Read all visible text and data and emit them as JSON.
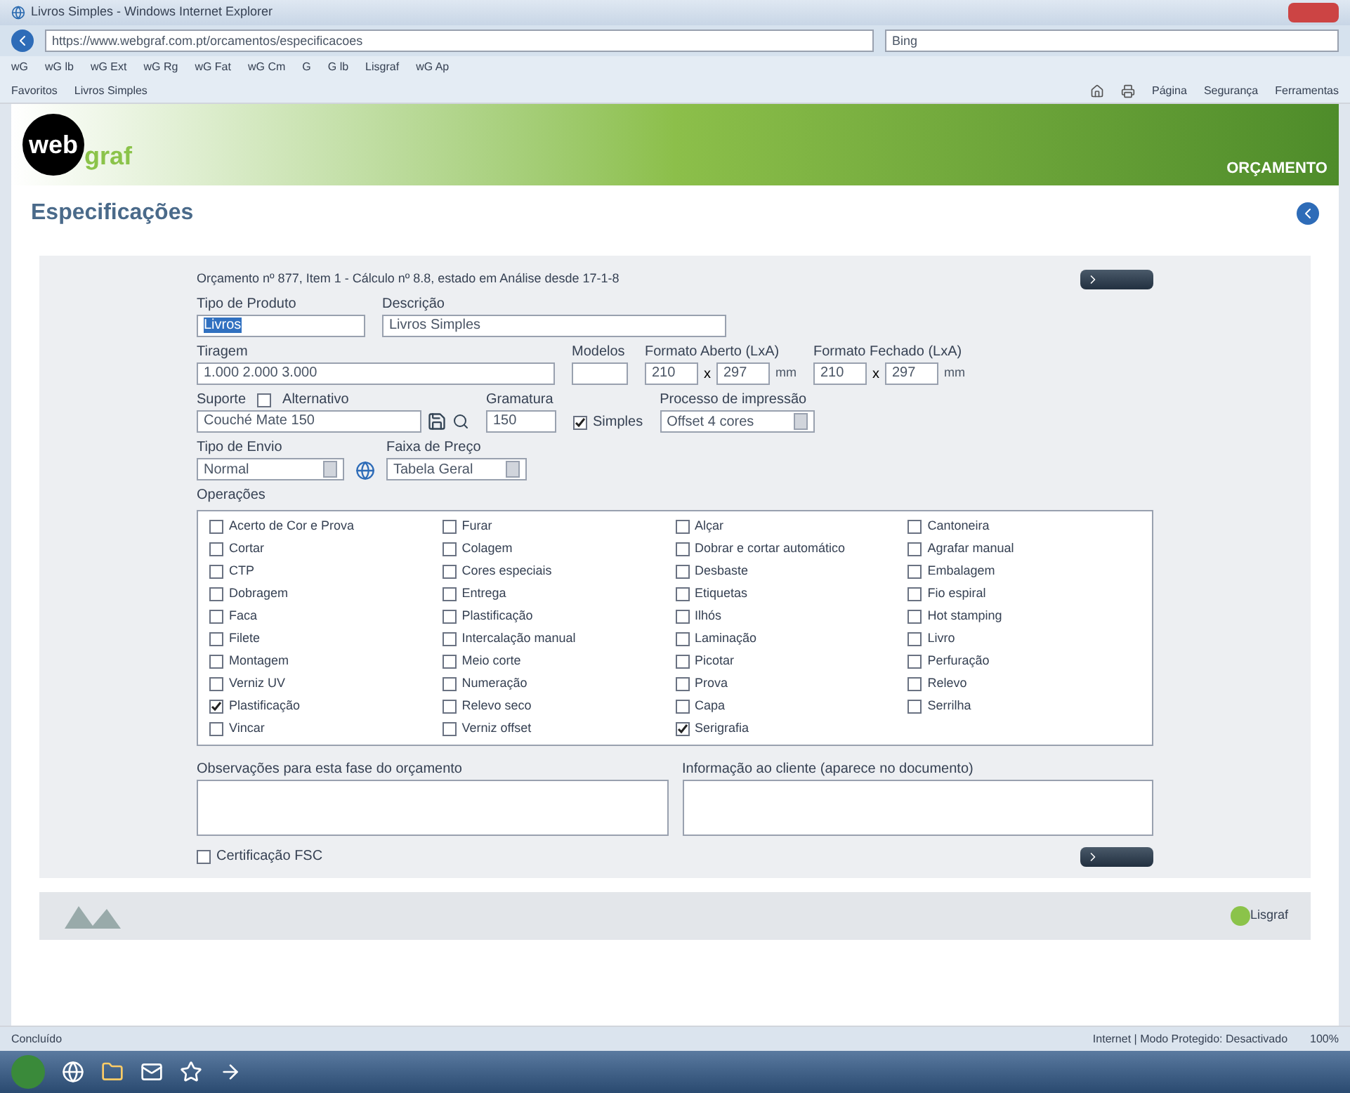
{
  "browser": {
    "title": "Livros Simples - Windows Internet Explorer",
    "address": "https://www.webgraf.com.pt/orcamentos/especificacoes",
    "search": "Bing",
    "favorites": [
      "Favoritos",
      "Livros Simples"
    ],
    "links": [
      "wG",
      "wG lb",
      "wG Ext",
      "wG Rg",
      "wG Fat",
      "wG Cm",
      "G",
      "G lb",
      "Lisgraf",
      "wG Ap"
    ],
    "commands": [
      "Página",
      "Segurança",
      "Ferramentas"
    ]
  },
  "banner": {
    "logo_top": "web",
    "logo_bottom": "graf",
    "section": "ORÇAMENTO"
  },
  "page": {
    "title": "Especificações"
  },
  "form": {
    "summary": "Orçamento nº 877, Item 1 - Cálculo nº 8.8, estado em Análise desde 17-1-8",
    "fields": [
      {
        "label": "Tipo de Produto",
        "value": "Livros"
      },
      {
        "label": "Descrição",
        "value": "Livros Simples"
      }
    ],
    "fields2": [
      {
        "kind": "text",
        "label": "Tiragem",
        "value": "1.000 2.000 3.000"
      },
      {
        "kind": "text",
        "label": "Modelos"
      },
      {
        "kind": "pair",
        "label": "Formato Aberto (LxA)",
        "value": "210",
        "separator": "x",
        "value2": "297",
        "unit": "mm"
      },
      {
        "kind": "pair",
        "label": "Formato Fechado (LxA)",
        "value": "210",
        "separator": "x",
        "value2": "297",
        "unit": "mm"
      }
    ],
    "support": {
      "label": "Suporte",
      "option": "Alternativo",
      "option_checked": false,
      "value": "Couché Mate 150"
    },
    "weight": {
      "label": "Gramatura",
      "value": "150"
    },
    "simplex": {
      "label": "Simples",
      "checked": true
    },
    "process": {
      "label": "Processo de impressão",
      "value": "Offset 4 cores"
    },
    "ship": {
      "label": "Tipo de Envio",
      "value": "Normal"
    },
    "range": {
      "label": "Faixa de Preço",
      "value": "Tabela Geral"
    },
    "operations_label": "Operações",
    "operations": [
      [
        {
          "label": "Acerto de Cor e Prova",
          "checked": false
        },
        {
          "label": "Cortar",
          "checked": false
        },
        {
          "label": "CTP",
          "checked": false
        },
        {
          "label": "Dobragem",
          "checked": false
        },
        {
          "label": "Faca",
          "checked": false
        },
        {
          "label": "Filete",
          "checked": false
        },
        {
          "label": "Montagem",
          "checked": false
        },
        {
          "label": "Verniz UV",
          "checked": false
        },
        {
          "label": "Plastificação",
          "checked": true
        },
        {
          "label": "Vincar",
          "checked": false
        }
      ],
      [
        {
          "label": "Furar",
          "checked": false
        },
        {
          "label": "Colagem",
          "checked": false
        },
        {
          "label": "Cores especiais",
          "checked": false
        },
        {
          "label": "Entrega",
          "checked": false
        },
        {
          "label": "Plastificação",
          "checked": false
        },
        {
          "label": "Intercalação manual",
          "checked": false
        },
        {
          "label": "Meio corte",
          "checked": false
        },
        {
          "label": "Numeração",
          "checked": false
        },
        {
          "label": "Relevo seco",
          "checked": false
        },
        {
          "label": "Verniz offset",
          "checked": false
        }
      ],
      [
        {
          "label": "Alçar",
          "checked": false
        },
        {
          "label": "Dobrar e cortar automático",
          "checked": false
        },
        {
          "label": "Desbaste",
          "checked": false
        },
        {
          "label": "Etiquetas",
          "checked": false
        },
        {
          "label": "Ilhós",
          "checked": false
        },
        {
          "label": "Laminação",
          "checked": false
        },
        {
          "label": "Picotar",
          "checked": false
        },
        {
          "label": "Prova",
          "checked": false
        },
        {
          "label": "Capa",
          "checked": false
        },
        {
          "label": "Serigrafia",
          "checked": true
        }
      ],
      [
        {
          "label": "Cantoneira",
          "checked": false
        },
        {
          "label": "Agrafar manual",
          "checked": false
        },
        {
          "label": "Embalagem",
          "checked": false
        },
        {
          "label": "Fio espiral",
          "checked": false
        },
        {
          "label": "Hot stamping",
          "checked": false
        },
        {
          "label": "Livro",
          "checked": false
        },
        {
          "label": "Perfuração",
          "checked": false
        },
        {
          "label": "Relevo",
          "checked": false
        },
        {
          "label": "Serrilha",
          "checked": false
        }
      ]
    ],
    "notes": [
      {
        "label": "Observações para esta fase do orçamento"
      },
      {
        "label": "Informação ao cliente (aparece no documento)"
      }
    ],
    "fsc": {
      "label": "Certificação FSC",
      "checked": false
    }
  },
  "footer": {
    "brand": "Lisgraf"
  },
  "status": {
    "left": "Concluído",
    "zone": "Internet | Modo Protegido: Desactivado",
    "zoom": "100%"
  }
}
